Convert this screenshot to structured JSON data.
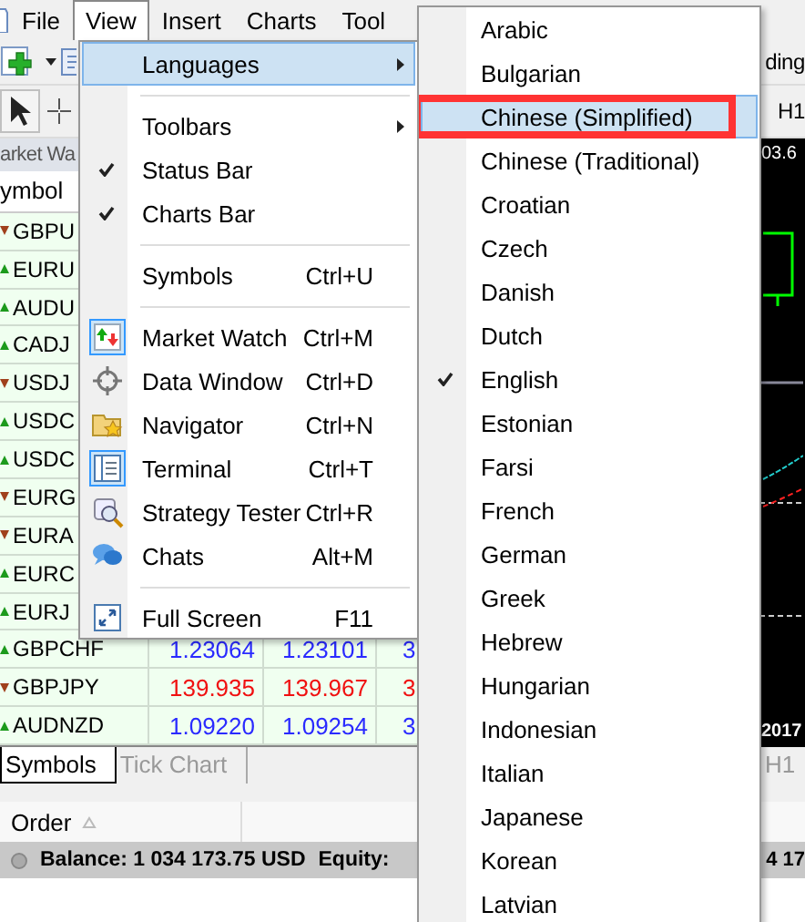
{
  "menu_bar": [
    {
      "label": "File",
      "selected": false
    },
    {
      "label": "View",
      "selected": true
    },
    {
      "label": "Insert",
      "selected": false
    },
    {
      "label": "Charts",
      "selected": false
    },
    {
      "label": "Tool",
      "selected": false
    }
  ],
  "toolbar": {
    "button_text": "ding",
    "timeframe": "H1"
  },
  "market_watch": {
    "title": "arket Wa",
    "column": "ymbol",
    "rows": [
      {
        "symbol": "GBPU",
        "rising": false
      },
      {
        "symbol": "EURU",
        "rising": true
      },
      {
        "symbol": "AUDU",
        "rising": true
      },
      {
        "symbol": "CADJ",
        "rising": true
      },
      {
        "symbol": "USDJ",
        "rising": false
      },
      {
        "symbol": "USDC",
        "rising": true
      },
      {
        "symbol": "USDC",
        "rising": true
      },
      {
        "symbol": "EURG",
        "rising": false
      },
      {
        "symbol": "EURA",
        "rising": false
      },
      {
        "symbol": "EURC",
        "rising": true
      },
      {
        "symbol": "EURJ",
        "rising": true
      },
      {
        "symbol": "GBPCHF",
        "rising": true,
        "bid": "1.23064",
        "ask": "1.23101",
        "column_3": "3"
      },
      {
        "symbol": "GBPJPY",
        "rising": false,
        "bid": "139.935",
        "ask": "139.967",
        "column_3": "3"
      },
      {
        "symbol": "AUDNZD",
        "rising": true,
        "bid": "1.09220",
        "ask": "1.09254",
        "column_3": "3"
      }
    ]
  },
  "tabs": [
    {
      "label": "Symbols",
      "selected": true
    },
    {
      "label": "Tick Chart",
      "selected": false
    }
  ],
  "chart": {
    "price": "03.6",
    "date": "2017",
    "tab": "H1"
  },
  "terminal": {
    "column": "Order"
  },
  "status_bar": {
    "balance": "Balance: 1 034 173.75 USD",
    "equity": "Equity:",
    "column_3": "4 17"
  },
  "view_menu": {
    "items": [
      {
        "kind": "item",
        "label": "Languages",
        "submenu": true,
        "selected": true
      },
      {
        "kind": "separator"
      },
      {
        "kind": "item",
        "label": "Toolbars",
        "submenu": true,
        "selected": false
      },
      {
        "kind": "item",
        "label": "Status Bar",
        "checked": true,
        "selected": false
      },
      {
        "kind": "item",
        "label": "Charts Bar",
        "checked": true,
        "selected": false
      },
      {
        "kind": "separator"
      },
      {
        "kind": "item",
        "label": "Symbols",
        "shortcut": "Ctrl+U",
        "selected": false
      },
      {
        "kind": "separator"
      },
      {
        "kind": "item",
        "label": "Market Watch",
        "shortcut": "Ctrl+M",
        "on": true,
        "selected": false
      },
      {
        "kind": "item",
        "label": "Data Window",
        "shortcut": "Ctrl+D",
        "on": false,
        "selected": false
      },
      {
        "kind": "item",
        "label": "Navigator",
        "shortcut": "Ctrl+N",
        "on": false,
        "selected": false
      },
      {
        "kind": "item",
        "label": "Terminal",
        "shortcut": "Ctrl+T",
        "on": true,
        "selected": false
      },
      {
        "kind": "item",
        "label": "Strategy Tester",
        "shortcut": "Ctrl+R",
        "on": false,
        "selected": false
      },
      {
        "kind": "item",
        "label": "Chats",
        "shortcut": "Alt+M",
        "on": false,
        "selected": false
      },
      {
        "kind": "separator"
      },
      {
        "kind": "item",
        "label": "Full Screen",
        "shortcut": "F11",
        "on": false,
        "selected": false
      }
    ]
  },
  "languages_menu": {
    "items": [
      {
        "kind": "item",
        "label": "Arabic",
        "checked": false,
        "selected": false
      },
      {
        "kind": "item",
        "label": "Bulgarian",
        "checked": false,
        "selected": false
      },
      {
        "kind": "item",
        "label": "Chinese (Simplified)",
        "checked": false,
        "selected": true
      },
      {
        "kind": "item",
        "label": "Chinese (Traditional)",
        "checked": false,
        "selected": false
      },
      {
        "kind": "item",
        "label": "Croatian",
        "checked": false,
        "selected": false
      },
      {
        "kind": "item",
        "label": "Czech",
        "checked": false,
        "selected": false
      },
      {
        "kind": "item",
        "label": "Danish",
        "checked": false,
        "selected": false
      },
      {
        "kind": "item",
        "label": "Dutch",
        "checked": false,
        "selected": false
      },
      {
        "kind": "item",
        "label": "English",
        "checked": true,
        "selected": false
      },
      {
        "kind": "item",
        "label": "Estonian",
        "checked": false,
        "selected": false
      },
      {
        "kind": "item",
        "label": "Farsi",
        "checked": false,
        "selected": false
      },
      {
        "kind": "item",
        "label": "French",
        "checked": false,
        "selected": false
      },
      {
        "kind": "item",
        "label": "German",
        "checked": false,
        "selected": false
      },
      {
        "kind": "item",
        "label": "Greek",
        "checked": false,
        "selected": false
      },
      {
        "kind": "item",
        "label": "Hebrew",
        "checked": false,
        "selected": false
      },
      {
        "kind": "item",
        "label": "Hungarian",
        "checked": false,
        "selected": false
      },
      {
        "kind": "item",
        "label": "Indonesian",
        "checked": false,
        "selected": false
      },
      {
        "kind": "item",
        "label": "Italian",
        "checked": false,
        "selected": false
      },
      {
        "kind": "item",
        "label": "Japanese",
        "checked": false,
        "selected": false
      },
      {
        "kind": "item",
        "label": "Korean",
        "checked": false,
        "selected": false
      },
      {
        "kind": "item",
        "label": "Latvian",
        "checked": false,
        "selected": false
      }
    ]
  }
}
